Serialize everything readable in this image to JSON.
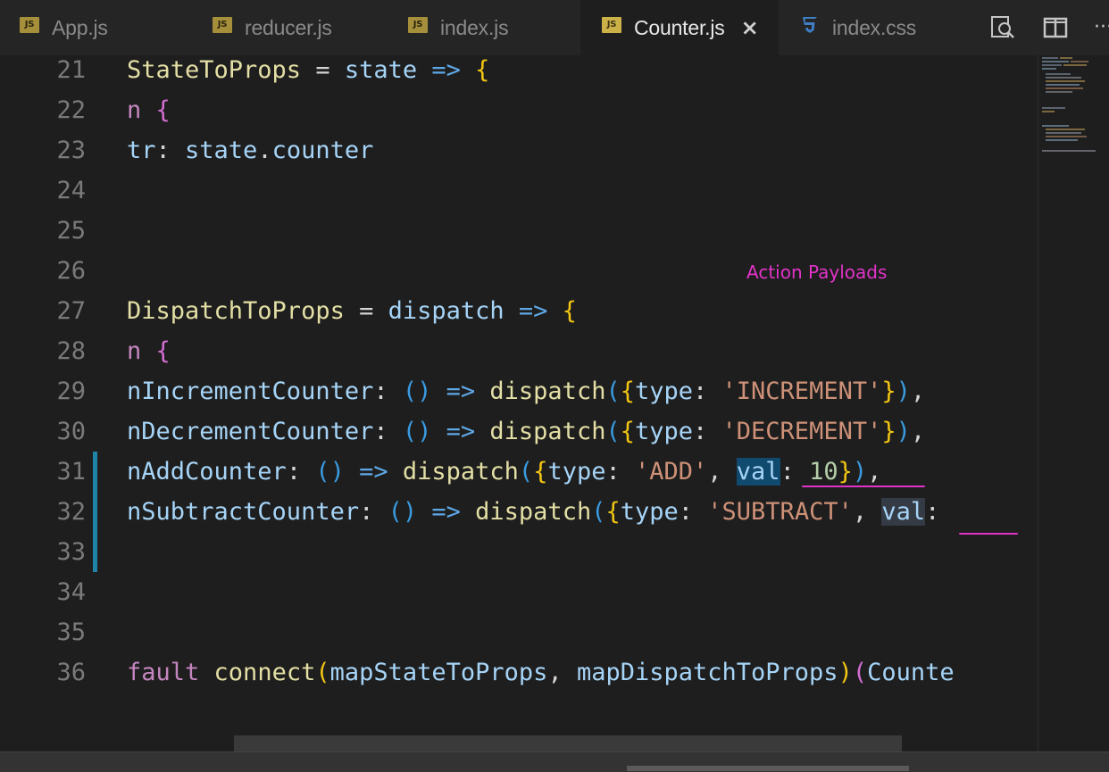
{
  "tabs": [
    {
      "name": "App.js",
      "icon": "js-file-icon",
      "active": false
    },
    {
      "name": "reducer.js",
      "icon": "js-file-icon",
      "active": false
    },
    {
      "name": "index.js",
      "icon": "js-file-icon",
      "active": false
    },
    {
      "name": "Counter.js",
      "icon": "js-file-icon",
      "active": true
    },
    {
      "name": "index.css",
      "icon": "css-file-icon",
      "active": false
    }
  ],
  "icons": {
    "js_badge": "JS",
    "close": "×",
    "more": "···",
    "toolbar": [
      "open-preview-icon",
      "split-editor-icon",
      "more-actions-icon"
    ]
  },
  "annotation": "Action Payloads",
  "lines": [
    {
      "n": "21",
      "tokens": [
        [
          "fn",
          "StateToProps"
        ],
        [
          "pun",
          " = "
        ],
        [
          "var",
          "state"
        ],
        [
          "op",
          " => "
        ],
        [
          "br1",
          "{"
        ]
      ]
    },
    {
      "n": "22",
      "tokens": [
        [
          "kw",
          "n "
        ],
        [
          "br2",
          "{"
        ]
      ]
    },
    {
      "n": "23",
      "tokens": [
        [
          "var",
          "tr"
        ],
        [
          "pun",
          ": "
        ],
        [
          "var",
          "state"
        ],
        [
          "pun",
          "."
        ],
        [
          "var",
          "counter"
        ]
      ]
    },
    {
      "n": "24",
      "tokens": []
    },
    {
      "n": "25",
      "tokens": []
    },
    {
      "n": "26",
      "tokens": []
    },
    {
      "n": "27",
      "tokens": [
        [
          "fn",
          "DispatchToProps"
        ],
        [
          "pun",
          " = "
        ],
        [
          "var",
          "dispatch"
        ],
        [
          "op",
          " => "
        ],
        [
          "br1",
          "{"
        ]
      ]
    },
    {
      "n": "28",
      "tokens": [
        [
          "kw",
          "n "
        ],
        [
          "br2",
          "{"
        ]
      ]
    },
    {
      "n": "29",
      "tokens": [
        [
          "var",
          "nIncrementCounter"
        ],
        [
          "pun",
          ": "
        ],
        [
          "br3",
          "()"
        ],
        [
          "op",
          " => "
        ],
        [
          "fn",
          "dispatch"
        ],
        [
          "br3",
          "("
        ],
        [
          "br1",
          "{"
        ],
        [
          "var",
          "type"
        ],
        [
          "pun",
          ": "
        ],
        [
          "str",
          "'INCREMENT'"
        ],
        [
          "br1",
          "}"
        ],
        [
          "br3",
          ")"
        ],
        [
          "pun",
          ","
        ]
      ]
    },
    {
      "n": "30",
      "tokens": [
        [
          "var",
          "nDecrementCounter"
        ],
        [
          "pun",
          ": "
        ],
        [
          "br3",
          "()"
        ],
        [
          "op",
          " => "
        ],
        [
          "fn",
          "dispatch"
        ],
        [
          "br3",
          "("
        ],
        [
          "br1",
          "{"
        ],
        [
          "var",
          "type"
        ],
        [
          "pun",
          ": "
        ],
        [
          "str",
          "'DECREMENT'"
        ],
        [
          "br1",
          "}"
        ],
        [
          "br3",
          ")"
        ],
        [
          "pun",
          ","
        ]
      ]
    },
    {
      "n": "31",
      "mark": true,
      "tokens": [
        [
          "var",
          "nAddCounter"
        ],
        [
          "pun",
          ": "
        ],
        [
          "br3",
          "()"
        ],
        [
          "op",
          " => "
        ],
        [
          "fn",
          "dispatch"
        ],
        [
          "br3",
          "("
        ],
        [
          "br1",
          "{"
        ],
        [
          "var",
          "type"
        ],
        [
          "pun",
          ": "
        ],
        [
          "str",
          "'ADD'"
        ],
        [
          "pun",
          ", "
        ],
        [
          "var hl",
          "val"
        ],
        [
          "pun",
          ": "
        ],
        [
          "num",
          "10"
        ],
        [
          "br1",
          "}"
        ],
        [
          "br3",
          ")"
        ],
        [
          "pun",
          ","
        ]
      ]
    },
    {
      "n": "32",
      "mark": true,
      "tokens": [
        [
          "var",
          "nSubtractCounter"
        ],
        [
          "pun",
          ": "
        ],
        [
          "br3",
          "()"
        ],
        [
          "op",
          " => "
        ],
        [
          "fn",
          "dispatch"
        ],
        [
          "br3",
          "("
        ],
        [
          "br1",
          "{"
        ],
        [
          "var",
          "type"
        ],
        [
          "pun",
          ": "
        ],
        [
          "str",
          "'SUBTRACT'"
        ],
        [
          "pun",
          ", "
        ],
        [
          "var hl2",
          "val"
        ],
        [
          "pun",
          ":"
        ]
      ]
    },
    {
      "n": "33",
      "mark": true,
      "tokens": []
    },
    {
      "n": "34",
      "tokens": []
    },
    {
      "n": "35",
      "tokens": []
    },
    {
      "n": "36",
      "tokens": [
        [
          "kw",
          "fault "
        ],
        [
          "fn",
          "connect"
        ],
        [
          "br1",
          "("
        ],
        [
          "var",
          "mapStateToProps"
        ],
        [
          "pun",
          ", "
        ],
        [
          "var",
          "mapDispatchToProps"
        ],
        [
          "br1",
          ")"
        ],
        [
          "br2",
          "("
        ],
        [
          "var",
          "Counte"
        ]
      ]
    }
  ]
}
